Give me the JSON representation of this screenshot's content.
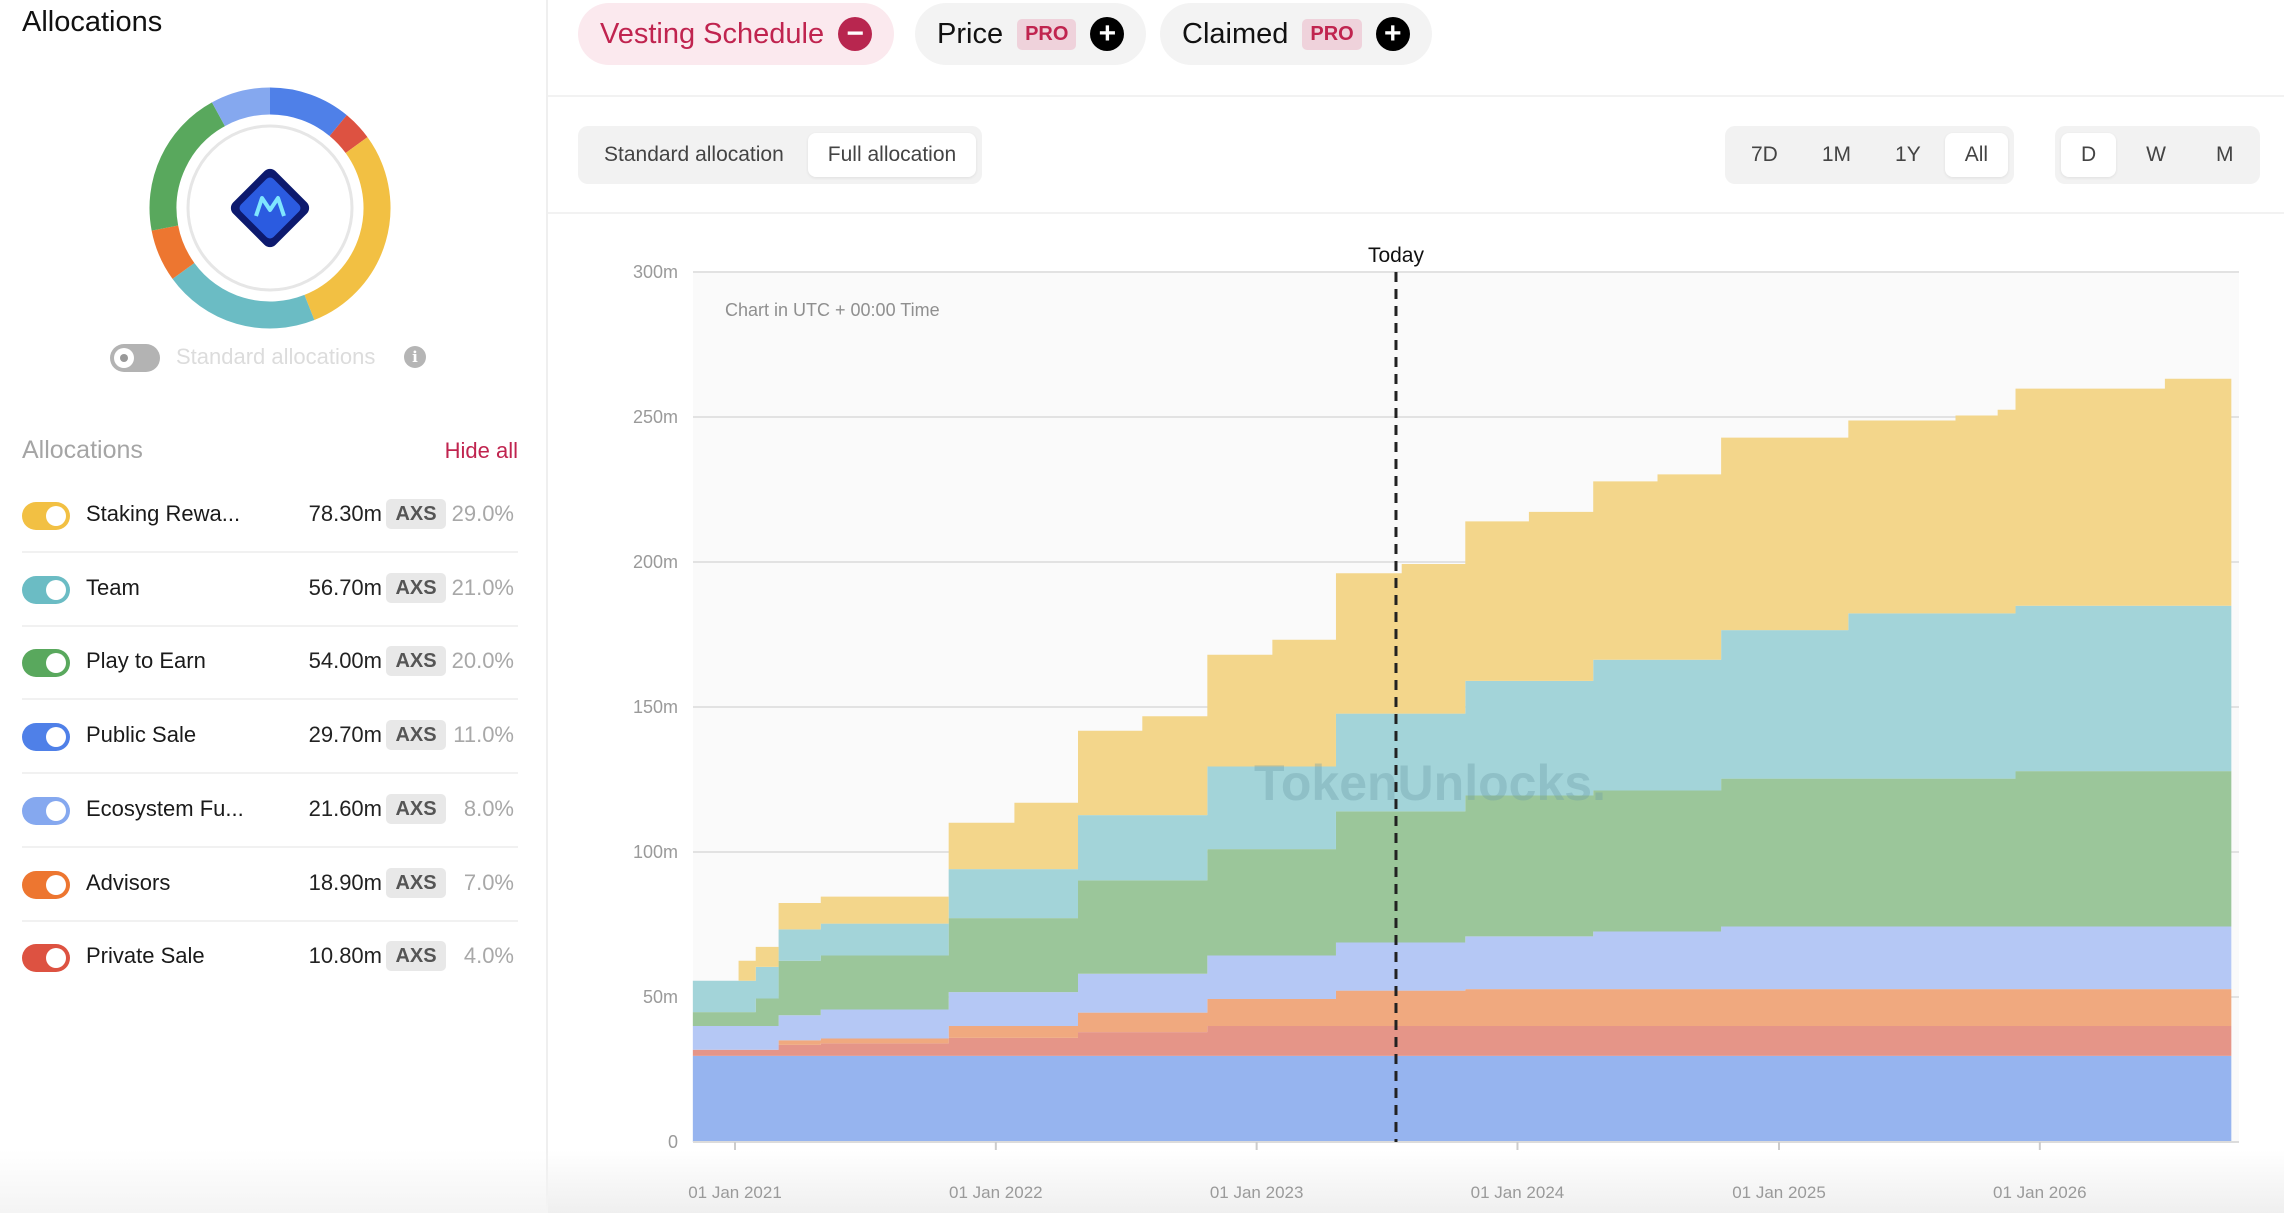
{
  "sidebar": {
    "title": "Allocations",
    "standard_toggle_label": "Standard allocations",
    "standard_toggle_on": false,
    "list_header": "Allocations",
    "hide_all": "Hide all",
    "items": [
      {
        "name": "Staking Rewa...",
        "value": "78.30m",
        "unit": "AXS",
        "pct": "29.0%",
        "percent": 29,
        "color": "#f2c043",
        "fill": "#f3d68b",
        "on": true
      },
      {
        "name": "Team",
        "value": "56.70m",
        "unit": "AXS",
        "pct": "21.0%",
        "percent": 21,
        "color": "#6bbcc4",
        "fill": "#a3d4d9",
        "on": true
      },
      {
        "name": "Play to Earn",
        "value": "54.00m",
        "unit": "AXS",
        "pct": "20.0%",
        "percent": 20,
        "color": "#59a85d",
        "fill": "#9bc69a",
        "on": true
      },
      {
        "name": "Public Sale",
        "value": "29.70m",
        "unit": "AXS",
        "pct": "11.0%",
        "percent": 11,
        "color": "#4f80e8",
        "fill": "#96b4ef",
        "on": true
      },
      {
        "name": "Ecosystem Fu...",
        "value": "21.60m",
        "unit": "AXS",
        "pct": "8.0%",
        "percent": 8,
        "color": "#85a8ef",
        "fill": "#b5c8f5",
        "on": true
      },
      {
        "name": "Advisors",
        "value": "18.90m",
        "unit": "AXS",
        "pct": "7.0%",
        "percent": 7,
        "color": "#ed7630",
        "fill": "#f0a97f",
        "on": true
      },
      {
        "name": "Private Sale",
        "value": "10.80m",
        "unit": "AXS",
        "pct": "4.0%",
        "percent": 4,
        "color": "#dd5241",
        "fill": "#e59588",
        "on": true
      }
    ],
    "donut_order": [
      "Public Sale",
      "Private Sale",
      "Staking Rewa...",
      "Team",
      "Advisors",
      "Play to Earn",
      "Ecosystem Fu..."
    ],
    "logo_icon": "axie-infinity-logo"
  },
  "tabs": [
    {
      "label": "Vesting Schedule",
      "active": true,
      "action_icon": "minus-icon"
    },
    {
      "label": "Price",
      "badge": "PRO",
      "active": false,
      "action_icon": "plus-icon"
    },
    {
      "label": "Claimed",
      "badge": "PRO",
      "active": false,
      "action_icon": "plus-icon"
    }
  ],
  "allocation_mode": {
    "options": [
      "Standard allocation",
      "Full allocation"
    ],
    "selected": "Full allocation"
  },
  "ranges": {
    "options": [
      "7D",
      "1M",
      "1Y",
      "All"
    ],
    "selected": "All"
  },
  "granularity": {
    "options": [
      "D",
      "W",
      "M"
    ],
    "selected": "D"
  },
  "accent_color": "#c0244f",
  "chart_data": {
    "type": "area",
    "stacked": true,
    "step": true,
    "note": "Chart in UTC + 00:00 Time",
    "today_label": "Today",
    "today_date": "2023-07-15",
    "watermark": "TokenUnlocks.",
    "ylim": [
      0,
      300
    ],
    "yticks": [
      {
        "v": 0,
        "label": "0"
      },
      {
        "v": 50,
        "label": "50m"
      },
      {
        "v": 100,
        "label": "100m"
      },
      {
        "v": 150,
        "label": "150m"
      },
      {
        "v": 200,
        "label": "200m"
      },
      {
        "v": 250,
        "label": "250m"
      },
      {
        "v": 300,
        "label": "300m"
      }
    ],
    "xticks": [
      {
        "date": "2021-01-01",
        "label": "01 Jan 2021"
      },
      {
        "date": "2022-01-01",
        "label": "01 Jan 2022"
      },
      {
        "date": "2023-01-01",
        "label": "01 Jan 2023"
      },
      {
        "date": "2024-01-01",
        "label": "01 Jan 2024"
      },
      {
        "date": "2025-01-01",
        "label": "01 Jan 2025"
      },
      {
        "date": "2026-01-01",
        "label": "01 Jan 2026"
      }
    ],
    "grid": true,
    "unit": "m AXS",
    "step_dates": [
      "2020-11-03",
      "2021-01-06",
      "2021-01-30",
      "2021-03-03",
      "2021-05-01",
      "2021-10-27",
      "2022-01-27",
      "2022-04-26",
      "2022-07-25",
      "2022-10-24",
      "2023-01-23",
      "2023-04-22",
      "2023-07-23",
      "2023-10-20",
      "2024-01-17",
      "2024-04-16",
      "2024-07-15",
      "2024-10-12",
      "2025-04-08",
      "2025-09-05",
      "2025-11-03",
      "2025-11-28",
      "2026-06-25"
    ],
    "end_date": "2026-09-26",
    "series": [
      {
        "name": "Public Sale",
        "values": [
          29.7,
          29.7,
          29.7,
          29.7,
          29.7,
          29.7,
          29.7,
          29.7,
          29.7,
          29.7,
          29.7,
          29.7,
          29.7,
          29.7,
          29.7,
          29.7,
          29.7,
          29.7,
          29.7,
          29.7,
          29.7,
          29.7,
          29.7
        ]
      },
      {
        "name": "Private Sale",
        "values": [
          2.1,
          2.1,
          2.1,
          3.8,
          4.3,
          6.2,
          6.2,
          8.2,
          8.2,
          10.3,
          10.3,
          10.3,
          10.3,
          10.3,
          10.3,
          10.3,
          10.3,
          10.3,
          10.3,
          10.3,
          10.3,
          10.3,
          10.3
        ]
      },
      {
        "name": "Advisors",
        "values": [
          0,
          0,
          0,
          1.6,
          1.7,
          4.1,
          4.1,
          6.7,
          6.7,
          9.3,
          9.3,
          12.2,
          12.2,
          12.7,
          12.7,
          12.7,
          12.7,
          12.7,
          12.7,
          12.7,
          12.7,
          12.7,
          12.7
        ]
      },
      {
        "name": "Ecosystem Fu...",
        "values": [
          8.2,
          8.2,
          8.2,
          8.6,
          10.0,
          11.7,
          11.7,
          13.4,
          13.4,
          15.0,
          15.0,
          16.6,
          16.6,
          18.2,
          18.2,
          19.9,
          19.9,
          21.6,
          21.6,
          21.6,
          21.6,
          21.6,
          21.6
        ]
      },
      {
        "name": "Play to Earn",
        "values": [
          4.8,
          4.8,
          9.5,
          18.8,
          18.6,
          25.5,
          25.5,
          32.2,
          32.2,
          36.7,
          36.7,
          45.2,
          45.2,
          48.6,
          48.6,
          48.6,
          48.6,
          51.0,
          51.0,
          51.0,
          51.0,
          53.6,
          53.6
        ]
      },
      {
        "name": "Team",
        "values": [
          10.8,
          10.8,
          10.9,
          10.8,
          11.0,
          16.9,
          16.9,
          22.5,
          22.5,
          28.5,
          28.5,
          33.7,
          33.7,
          39.5,
          39.5,
          45.1,
          45.1,
          51.2,
          57.0,
          57.0,
          57.0,
          57.0,
          57.0
        ]
      },
      {
        "name": "Staking Rewa...",
        "values": [
          0,
          6.9,
          6.9,
          9.1,
          9.3,
          16.0,
          22.9,
          29.1,
          34.1,
          38.5,
          43.7,
          48.4,
          51.6,
          55.0,
          58.3,
          61.5,
          63.9,
          66.4,
          66.5,
          68.2,
          70.2,
          74.9,
          78.3
        ]
      }
    ]
  }
}
